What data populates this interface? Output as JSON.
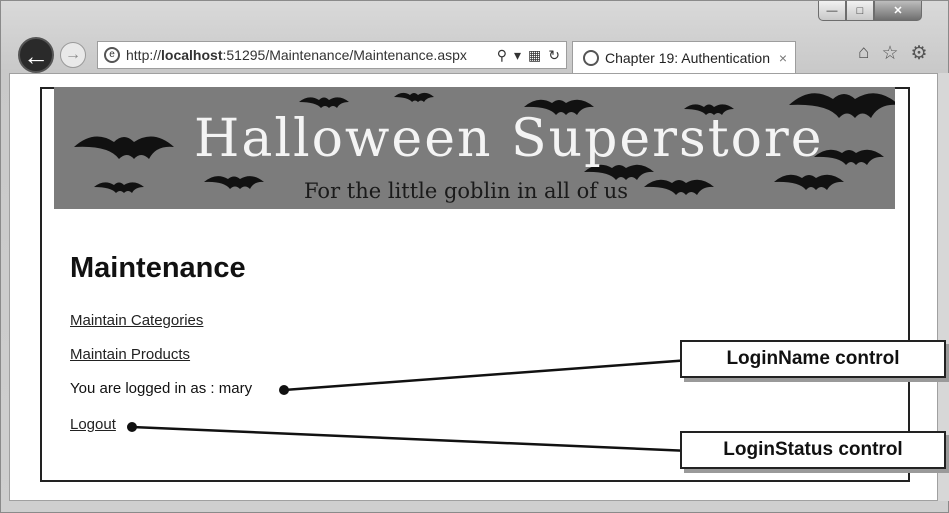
{
  "browser": {
    "url_prefix": "http://",
    "url_host": "localhost",
    "url_rest": ":51295/Maintenance/Maintenance.aspx",
    "tab_title": "Chapter 19: Authentication",
    "tab_close": "×",
    "back_icon": "back-arrow-icon",
    "forward_icon": "forward-arrow-icon",
    "address_icons": [
      "search-icon",
      "dropdown-icon",
      "compatibility-icon",
      "refresh-icon"
    ],
    "toolbar_icons": [
      "home-icon",
      "favorites-star-icon",
      "settings-gear-icon"
    ],
    "window_buttons": [
      "minimize",
      "maximize",
      "close"
    ]
  },
  "banner": {
    "title": "Halloween Superstore",
    "subtitle": "For the little goblin in all of us"
  },
  "page": {
    "title": "Maintenance",
    "links": {
      "categories": "Maintain Categories",
      "products": "Maintain Products",
      "logout": "Logout"
    },
    "logged_in_prefix": "You are logged in as : ",
    "logged_in_user": "mary"
  },
  "callouts": {
    "login_name": "LoginName control",
    "login_status": "LoginStatus control"
  }
}
